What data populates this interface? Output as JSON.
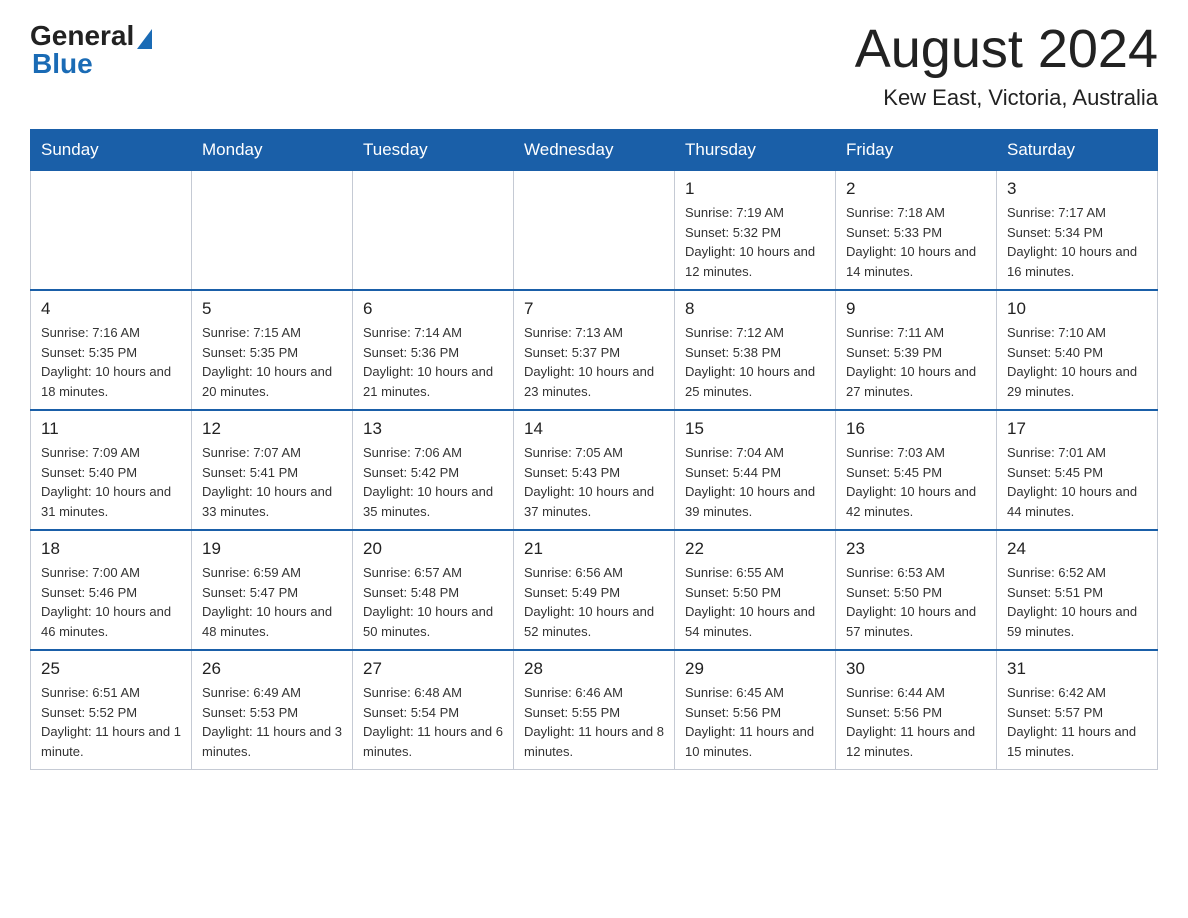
{
  "header": {
    "logo_general": "General",
    "logo_blue": "Blue",
    "month_title": "August 2024",
    "location": "Kew East, Victoria, Australia"
  },
  "days_of_week": [
    "Sunday",
    "Monday",
    "Tuesday",
    "Wednesday",
    "Thursday",
    "Friday",
    "Saturday"
  ],
  "weeks": [
    [
      {
        "day": "",
        "info": ""
      },
      {
        "day": "",
        "info": ""
      },
      {
        "day": "",
        "info": ""
      },
      {
        "day": "",
        "info": ""
      },
      {
        "day": "1",
        "info": "Sunrise: 7:19 AM\nSunset: 5:32 PM\nDaylight: 10 hours and 12 minutes."
      },
      {
        "day": "2",
        "info": "Sunrise: 7:18 AM\nSunset: 5:33 PM\nDaylight: 10 hours and 14 minutes."
      },
      {
        "day": "3",
        "info": "Sunrise: 7:17 AM\nSunset: 5:34 PM\nDaylight: 10 hours and 16 minutes."
      }
    ],
    [
      {
        "day": "4",
        "info": "Sunrise: 7:16 AM\nSunset: 5:35 PM\nDaylight: 10 hours and 18 minutes."
      },
      {
        "day": "5",
        "info": "Sunrise: 7:15 AM\nSunset: 5:35 PM\nDaylight: 10 hours and 20 minutes."
      },
      {
        "day": "6",
        "info": "Sunrise: 7:14 AM\nSunset: 5:36 PM\nDaylight: 10 hours and 21 minutes."
      },
      {
        "day": "7",
        "info": "Sunrise: 7:13 AM\nSunset: 5:37 PM\nDaylight: 10 hours and 23 minutes."
      },
      {
        "day": "8",
        "info": "Sunrise: 7:12 AM\nSunset: 5:38 PM\nDaylight: 10 hours and 25 minutes."
      },
      {
        "day": "9",
        "info": "Sunrise: 7:11 AM\nSunset: 5:39 PM\nDaylight: 10 hours and 27 minutes."
      },
      {
        "day": "10",
        "info": "Sunrise: 7:10 AM\nSunset: 5:40 PM\nDaylight: 10 hours and 29 minutes."
      }
    ],
    [
      {
        "day": "11",
        "info": "Sunrise: 7:09 AM\nSunset: 5:40 PM\nDaylight: 10 hours and 31 minutes."
      },
      {
        "day": "12",
        "info": "Sunrise: 7:07 AM\nSunset: 5:41 PM\nDaylight: 10 hours and 33 minutes."
      },
      {
        "day": "13",
        "info": "Sunrise: 7:06 AM\nSunset: 5:42 PM\nDaylight: 10 hours and 35 minutes."
      },
      {
        "day": "14",
        "info": "Sunrise: 7:05 AM\nSunset: 5:43 PM\nDaylight: 10 hours and 37 minutes."
      },
      {
        "day": "15",
        "info": "Sunrise: 7:04 AM\nSunset: 5:44 PM\nDaylight: 10 hours and 39 minutes."
      },
      {
        "day": "16",
        "info": "Sunrise: 7:03 AM\nSunset: 5:45 PM\nDaylight: 10 hours and 42 minutes."
      },
      {
        "day": "17",
        "info": "Sunrise: 7:01 AM\nSunset: 5:45 PM\nDaylight: 10 hours and 44 minutes."
      }
    ],
    [
      {
        "day": "18",
        "info": "Sunrise: 7:00 AM\nSunset: 5:46 PM\nDaylight: 10 hours and 46 minutes."
      },
      {
        "day": "19",
        "info": "Sunrise: 6:59 AM\nSunset: 5:47 PM\nDaylight: 10 hours and 48 minutes."
      },
      {
        "day": "20",
        "info": "Sunrise: 6:57 AM\nSunset: 5:48 PM\nDaylight: 10 hours and 50 minutes."
      },
      {
        "day": "21",
        "info": "Sunrise: 6:56 AM\nSunset: 5:49 PM\nDaylight: 10 hours and 52 minutes."
      },
      {
        "day": "22",
        "info": "Sunrise: 6:55 AM\nSunset: 5:50 PM\nDaylight: 10 hours and 54 minutes."
      },
      {
        "day": "23",
        "info": "Sunrise: 6:53 AM\nSunset: 5:50 PM\nDaylight: 10 hours and 57 minutes."
      },
      {
        "day": "24",
        "info": "Sunrise: 6:52 AM\nSunset: 5:51 PM\nDaylight: 10 hours and 59 minutes."
      }
    ],
    [
      {
        "day": "25",
        "info": "Sunrise: 6:51 AM\nSunset: 5:52 PM\nDaylight: 11 hours and 1 minute."
      },
      {
        "day": "26",
        "info": "Sunrise: 6:49 AM\nSunset: 5:53 PM\nDaylight: 11 hours and 3 minutes."
      },
      {
        "day": "27",
        "info": "Sunrise: 6:48 AM\nSunset: 5:54 PM\nDaylight: 11 hours and 6 minutes."
      },
      {
        "day": "28",
        "info": "Sunrise: 6:46 AM\nSunset: 5:55 PM\nDaylight: 11 hours and 8 minutes."
      },
      {
        "day": "29",
        "info": "Sunrise: 6:45 AM\nSunset: 5:56 PM\nDaylight: 11 hours and 10 minutes."
      },
      {
        "day": "30",
        "info": "Sunrise: 6:44 AM\nSunset: 5:56 PM\nDaylight: 11 hours and 12 minutes."
      },
      {
        "day": "31",
        "info": "Sunrise: 6:42 AM\nSunset: 5:57 PM\nDaylight: 11 hours and 15 minutes."
      }
    ]
  ]
}
